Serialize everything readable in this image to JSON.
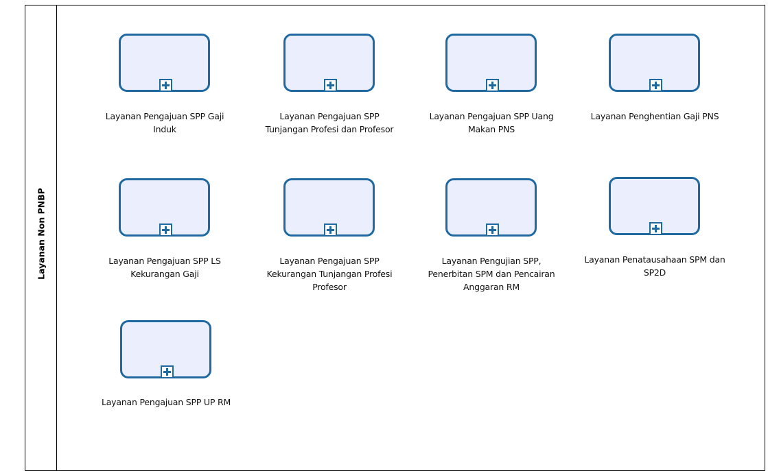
{
  "lane": {
    "label": "Layanan Non PNBP"
  },
  "tasks": [
    {
      "label_lines": [
        "Layanan Pengajuan SPP Gaji",
        "Induk"
      ]
    },
    {
      "label_lines": [
        "Layanan Pengajuan SPP",
        "Tunjangan Profesi dan Profesor"
      ]
    },
    {
      "label_lines": [
        "Layanan Pengajuan SPP Uang",
        "Makan PNS"
      ]
    },
    {
      "label_lines": [
        "Layanan Penghentian Gaji PNS"
      ]
    },
    {
      "label_lines": [
        "Layanan Pengajuan SPP LS",
        "Kekurangan Gaji"
      ]
    },
    {
      "label_lines": [
        "Layanan Pengajuan SPP",
        "Kekurangan Tunjangan Profesi",
        "Profesor"
      ]
    },
    {
      "label_lines": [
        "Layanan Pengujian SPP,",
        "Penerbitan SPM dan Pencairan",
        "Anggaran RM"
      ]
    },
    {
      "label_lines": [
        "Layanan Penatausahaan SPM dan",
        "SP2D"
      ]
    },
    {
      "label_lines": [
        "Layanan Pengajuan SPP UP RM"
      ]
    }
  ],
  "colors": {
    "task_fill": "#ebeefc",
    "task_border": "#1f68a0",
    "lane_border": "#000000"
  }
}
